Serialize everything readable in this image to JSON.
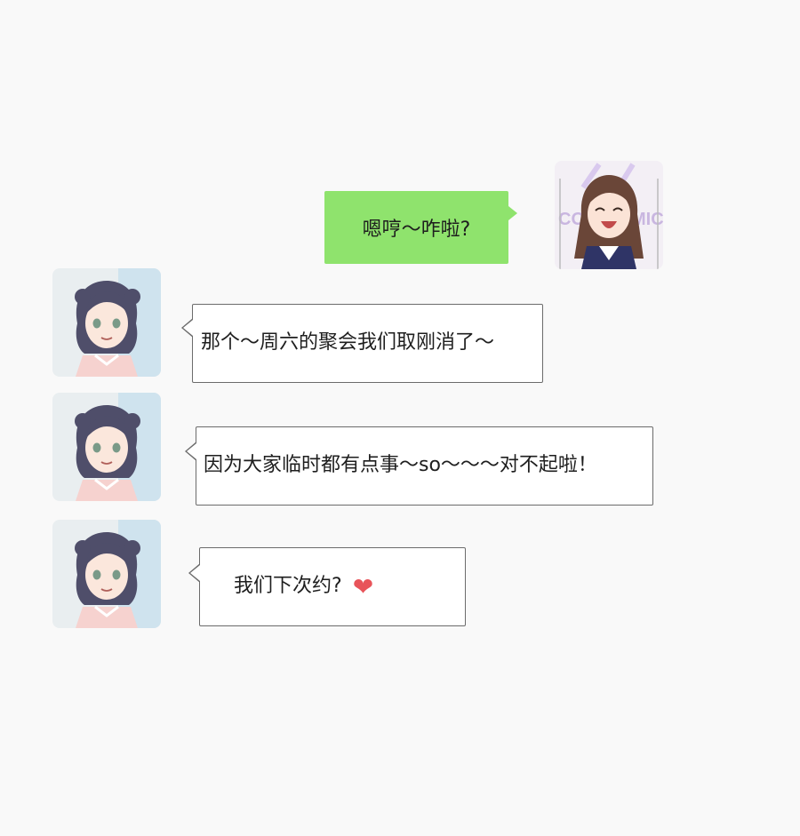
{
  "conversation": {
    "messages": [
      {
        "sender": "self",
        "text": "嗯哼～咋啦?"
      },
      {
        "sender": "friend",
        "text": "那个～周六的聚会我们取刚消了～"
      },
      {
        "sender": "friend",
        "text": "因为大家临时都有点事～so～～～对不起啦！"
      },
      {
        "sender": "friend",
        "text": "我们下次约?",
        "emoji": "heart-icon"
      }
    ]
  },
  "avatars": {
    "self": {
      "description": "laughing-girl-avatar",
      "bg_letters": "CO MIC"
    },
    "friend": {
      "description": "short-hair-girl-avatar"
    }
  },
  "colors": {
    "background": "#f9f9f9",
    "outgoing_bubble": "#8fe36d",
    "incoming_bubble": "#ffffff",
    "bubble_border": "#6b6b6b",
    "heart": "#e8545a"
  }
}
